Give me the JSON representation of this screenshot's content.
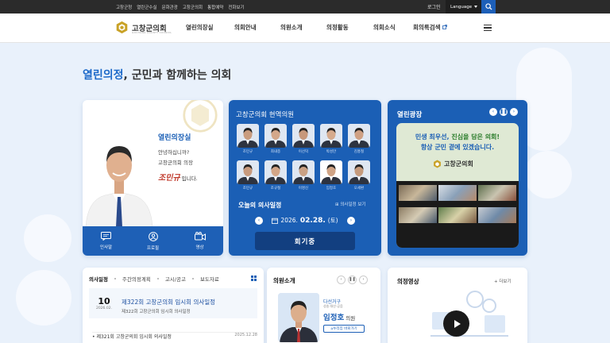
{
  "topbar": {
    "links": [
      "고창군청",
      "열린군수실",
      "문화관광",
      "고창군의회",
      "통합예약",
      "전화보기"
    ],
    "login": "로그인",
    "language": "Language"
  },
  "header": {
    "logo_name": "고창군의회",
    "logo_sub": "GOCHANG COUNTY COUNCIL",
    "nav": [
      "열린의장실",
      "의회안내",
      "의원소개",
      "의정활동",
      "의회소식",
      "회의록검색"
    ]
  },
  "slogan": {
    "highlight": "열린의정",
    "rest": ", 군민과 함께하는 의회"
  },
  "chairman": {
    "title": "열린의장실",
    "greeting_1": "안녕하십니까?",
    "greeting_2": "고창군의회 의장",
    "signature": "조민규",
    "signature_suffix": "입니다.",
    "menu": [
      "인사말",
      "프로필",
      "영상"
    ]
  },
  "members_card": {
    "title": "고창군의회 현역의원",
    "members": [
      "조민규",
      "최내종",
      "이선덕",
      "박성만",
      "김홍철",
      "조민규",
      "조규철",
      "이명신",
      "임정호",
      "오세환"
    ],
    "agenda_title": "오늘의 의사일정",
    "agenda_more": "의사일정 보기",
    "date_prefix": "2026.",
    "date_main": "02.28.",
    "date_day": "(토)",
    "status": "회기중"
  },
  "square": {
    "title": "열린광장",
    "banner_line1_a": "민생 최우선, ",
    "banner_line1_b": "진심을 담은 의회!",
    "banner_line2": "항상 군민 곁에 있겠습니다.",
    "banner_logo": "고창군의회"
  },
  "news": {
    "tabs": [
      "의사일정",
      "주간의정계획",
      "고시/공고",
      "보도자료"
    ],
    "featured_day": "10",
    "featured_ym": "2026.02.",
    "featured_title": "제322회 고창군의회 임시회 의사일정",
    "featured_sub": "제322회 고창군의회 임시회 의사일정",
    "item_title": "• 제321회 고창군의회 임시회 의사일정",
    "item_date": "2025.12.28"
  },
  "member_intro": {
    "title": "의원소개",
    "district": "다선거구",
    "area": "성송·대산·공음",
    "name": "임정호",
    "role": " 의원",
    "button": "누리집 바로가기"
  },
  "video": {
    "title": "의정영상",
    "more": "더보기"
  },
  "colors": {
    "primary": "#1b5fb5",
    "accent_text": "#1c69c9",
    "dark_bar": "#2b2b2b"
  }
}
